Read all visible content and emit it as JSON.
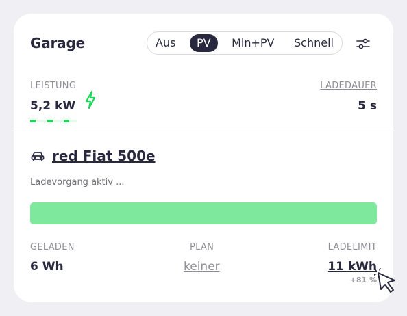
{
  "card": {
    "title": "Garage",
    "modes": [
      "Aus",
      "PV",
      "Min+PV",
      "Schnell"
    ],
    "active_mode": "PV",
    "power": {
      "label": "LEISTUNG",
      "value": "5,2 kW"
    },
    "duration": {
      "label": "LADEDAUER",
      "value": "5 s"
    },
    "vehicle": {
      "name": "red Fiat 500e",
      "status": "Ladevorgang aktiv ..."
    },
    "charge_progress_percent": 100,
    "charged": {
      "label": "GELADEN",
      "value": "6 Wh"
    },
    "plan": {
      "label": "PLAN",
      "value": "keiner"
    },
    "limit": {
      "label": "LADELIMIT",
      "value": "11 kWh",
      "percent": "+81 %"
    }
  },
  "colors": {
    "accent_green": "#1fd65a",
    "progress_green": "#7ee89c",
    "dark": "#28293e",
    "muted": "#8d8d94"
  },
  "icons": [
    "sliders-icon",
    "lightning-icon",
    "car-icon",
    "cursor-icon"
  ]
}
